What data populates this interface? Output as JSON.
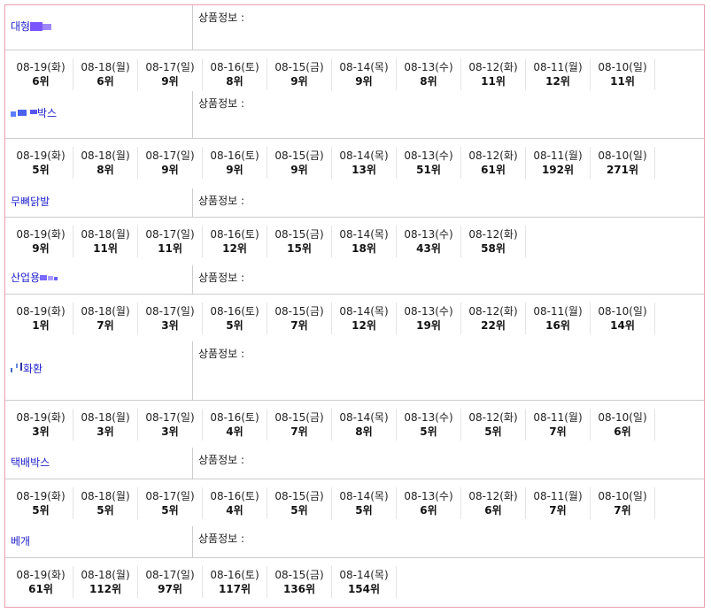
{
  "info_label": "상품정보 :",
  "products": [
    {
      "keyword": "대형",
      "redacted": true,
      "ranks": [
        {
          "date": "08-19(화)",
          "rank": "6위"
        },
        {
          "date": "08-18(월)",
          "rank": "6위"
        },
        {
          "date": "08-17(일)",
          "rank": "9위"
        },
        {
          "date": "08-16(토)",
          "rank": "8위"
        },
        {
          "date": "08-15(금)",
          "rank": "9위"
        },
        {
          "date": "08-14(목)",
          "rank": "9위"
        },
        {
          "date": "08-13(수)",
          "rank": "8위"
        },
        {
          "date": "08-12(화)",
          "rank": "11위"
        },
        {
          "date": "08-11(월)",
          "rank": "12위"
        },
        {
          "date": "08-10(일)",
          "rank": "11위"
        }
      ]
    },
    {
      "keyword": "박스",
      "redacted": true,
      "ranks": [
        {
          "date": "08-19(화)",
          "rank": "5위"
        },
        {
          "date": "08-18(월)",
          "rank": "8위"
        },
        {
          "date": "08-17(일)",
          "rank": "9위"
        },
        {
          "date": "08-16(토)",
          "rank": "9위"
        },
        {
          "date": "08-15(금)",
          "rank": "9위"
        },
        {
          "date": "08-14(목)",
          "rank": "13위"
        },
        {
          "date": "08-13(수)",
          "rank": "51위"
        },
        {
          "date": "08-12(화)",
          "rank": "61위"
        },
        {
          "date": "08-11(월)",
          "rank": "192위"
        },
        {
          "date": "08-10(일)",
          "rank": "271위"
        }
      ]
    },
    {
      "keyword": "무뼈닭발",
      "redacted": false,
      "ranks": [
        {
          "date": "08-19(화)",
          "rank": "9위"
        },
        {
          "date": "08-18(월)",
          "rank": "11위"
        },
        {
          "date": "08-17(일)",
          "rank": "11위"
        },
        {
          "date": "08-16(토)",
          "rank": "12위"
        },
        {
          "date": "08-15(금)",
          "rank": "15위"
        },
        {
          "date": "08-14(목)",
          "rank": "18위"
        },
        {
          "date": "08-13(수)",
          "rank": "43위"
        },
        {
          "date": "08-12(화)",
          "rank": "58위"
        }
      ]
    },
    {
      "keyword": "산업용",
      "redacted": true,
      "ranks": [
        {
          "date": "08-19(화)",
          "rank": "1위"
        },
        {
          "date": "08-18(월)",
          "rank": "7위"
        },
        {
          "date": "08-17(일)",
          "rank": "3위"
        },
        {
          "date": "08-16(토)",
          "rank": "5위"
        },
        {
          "date": "08-15(금)",
          "rank": "7위"
        },
        {
          "date": "08-14(목)",
          "rank": "12위"
        },
        {
          "date": "08-13(수)",
          "rank": "19위"
        },
        {
          "date": "08-12(화)",
          "rank": "22위"
        },
        {
          "date": "08-11(월)",
          "rank": "16위"
        },
        {
          "date": "08-10(일)",
          "rank": "14위"
        }
      ]
    },
    {
      "keyword": "화환",
      "redacted": true,
      "ranks": [
        {
          "date": "08-19(화)",
          "rank": "3위"
        },
        {
          "date": "08-18(월)",
          "rank": "3위"
        },
        {
          "date": "08-17(일)",
          "rank": "3위"
        },
        {
          "date": "08-16(토)",
          "rank": "4위"
        },
        {
          "date": "08-15(금)",
          "rank": "7위"
        },
        {
          "date": "08-14(목)",
          "rank": "8위"
        },
        {
          "date": "08-13(수)",
          "rank": "5위"
        },
        {
          "date": "08-12(화)",
          "rank": "5위"
        },
        {
          "date": "08-11(월)",
          "rank": "7위"
        },
        {
          "date": "08-10(일)",
          "rank": "6위"
        }
      ]
    },
    {
      "keyword": "택배박스",
      "redacted": false,
      "ranks": [
        {
          "date": "08-19(화)",
          "rank": "5위"
        },
        {
          "date": "08-18(월)",
          "rank": "5위"
        },
        {
          "date": "08-17(일)",
          "rank": "5위"
        },
        {
          "date": "08-16(토)",
          "rank": "4위"
        },
        {
          "date": "08-15(금)",
          "rank": "5위"
        },
        {
          "date": "08-14(목)",
          "rank": "5위"
        },
        {
          "date": "08-13(수)",
          "rank": "6위"
        },
        {
          "date": "08-12(화)",
          "rank": "6위"
        },
        {
          "date": "08-11(월)",
          "rank": "7위"
        },
        {
          "date": "08-10(일)",
          "rank": "7위"
        }
      ]
    },
    {
      "keyword": "베개",
      "redacted": false,
      "ranks": [
        {
          "date": "08-19(화)",
          "rank": "61위"
        },
        {
          "date": "08-18(월)",
          "rank": "112위"
        },
        {
          "date": "08-17(일)",
          "rank": "97위"
        },
        {
          "date": "08-16(토)",
          "rank": "117위"
        },
        {
          "date": "08-15(금)",
          "rank": "136위"
        },
        {
          "date": "08-14(목)",
          "rank": "154위"
        }
      ]
    }
  ]
}
